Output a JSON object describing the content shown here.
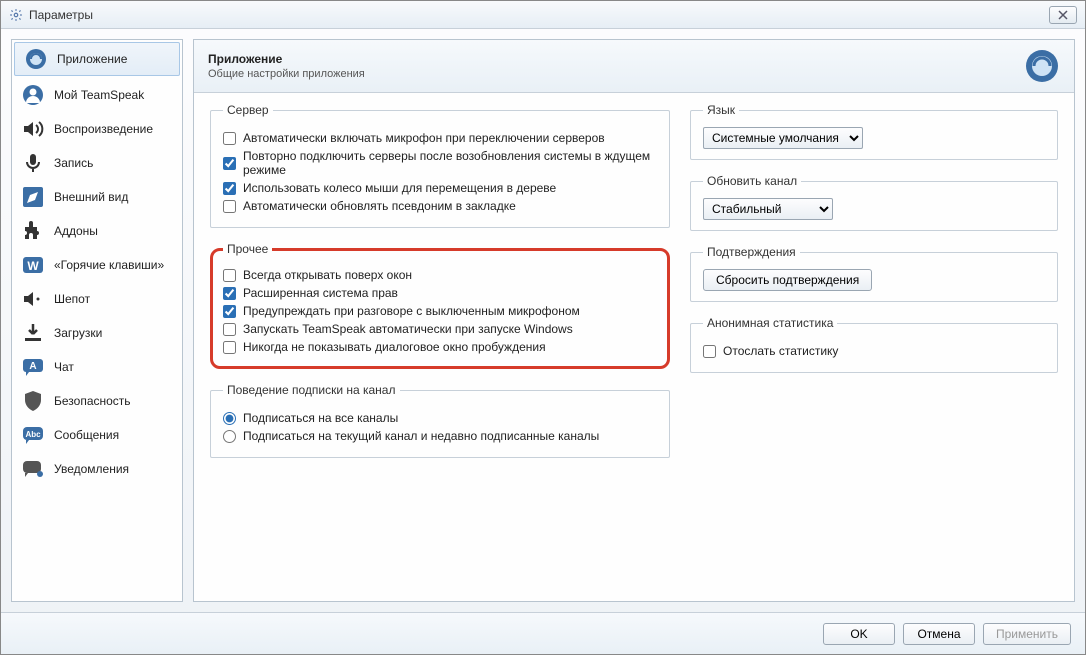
{
  "window": {
    "title": "Параметры"
  },
  "sidebar": {
    "items": [
      {
        "label": "Приложение"
      },
      {
        "label": "Мой TeamSpeak"
      },
      {
        "label": "Воспроизведение"
      },
      {
        "label": "Запись"
      },
      {
        "label": "Внешний вид"
      },
      {
        "label": "Аддоны"
      },
      {
        "label": "«Горячие клавиши»"
      },
      {
        "label": "Шепот"
      },
      {
        "label": "Загрузки"
      },
      {
        "label": "Чат"
      },
      {
        "label": "Безопасность"
      },
      {
        "label": "Сообщения"
      },
      {
        "label": "Уведомления"
      }
    ]
  },
  "header": {
    "title": "Приложение",
    "subtitle": "Общие настройки приложения"
  },
  "server": {
    "legend": "Сервер",
    "c1": "Автоматически включать микрофон при переключении серверов",
    "c2": "Повторно подключить серверы после возобновления системы в ждущем режиме",
    "c3": "Использовать колесо мыши для перемещения в дереве",
    "c4": "Автоматически обновлять псевдоним в закладке"
  },
  "other": {
    "legend": "Прочее",
    "c1": "Всегда открывать поверх окон",
    "c2": "Расширенная система прав",
    "c3": "Предупреждать при разговоре с выключенным микрофоном",
    "c4": "Запускать TeamSpeak автоматически при запуске Windows",
    "c5": "Никогда не показывать диалоговое окно пробуждения"
  },
  "subscribe": {
    "legend": "Поведение подписки на канал",
    "r1": "Подписаться на все каналы",
    "r2": "Подписаться на текущий канал и недавно подписанные каналы"
  },
  "lang": {
    "legend": "Язык",
    "value": "Системные умолчания"
  },
  "update": {
    "legend": "Обновить канал",
    "value": "Стабильный"
  },
  "confirm": {
    "legend": "Подтверждения",
    "button": "Сбросить подтверждения"
  },
  "anon": {
    "legend": "Анонимная статистика",
    "c1": "Отослать статистику"
  },
  "footer": {
    "ok": "OK",
    "cancel": "Отмена",
    "apply": "Применить"
  }
}
